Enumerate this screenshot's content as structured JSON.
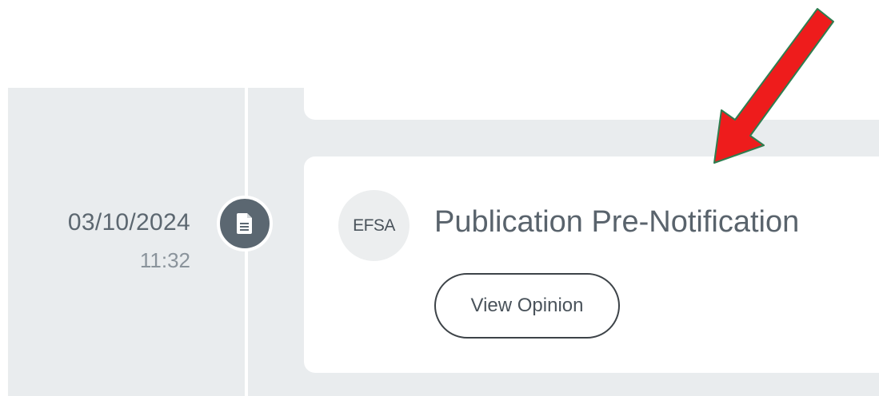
{
  "event": {
    "date": "03/10/2024",
    "time": "11:32",
    "node_icon": "document-icon",
    "org_badge": "EFSA",
    "title": "Publication Pre-Notification",
    "action_label": "View Opinion"
  },
  "colors": {
    "background": "#e9ecee",
    "card": "#ffffff",
    "node": "#5b6771",
    "annotation_arrow": "#ee1c1c",
    "annotation_arrow_outline": "#2e7d4f"
  },
  "annotation": {
    "icon": "red-arrow-icon"
  }
}
